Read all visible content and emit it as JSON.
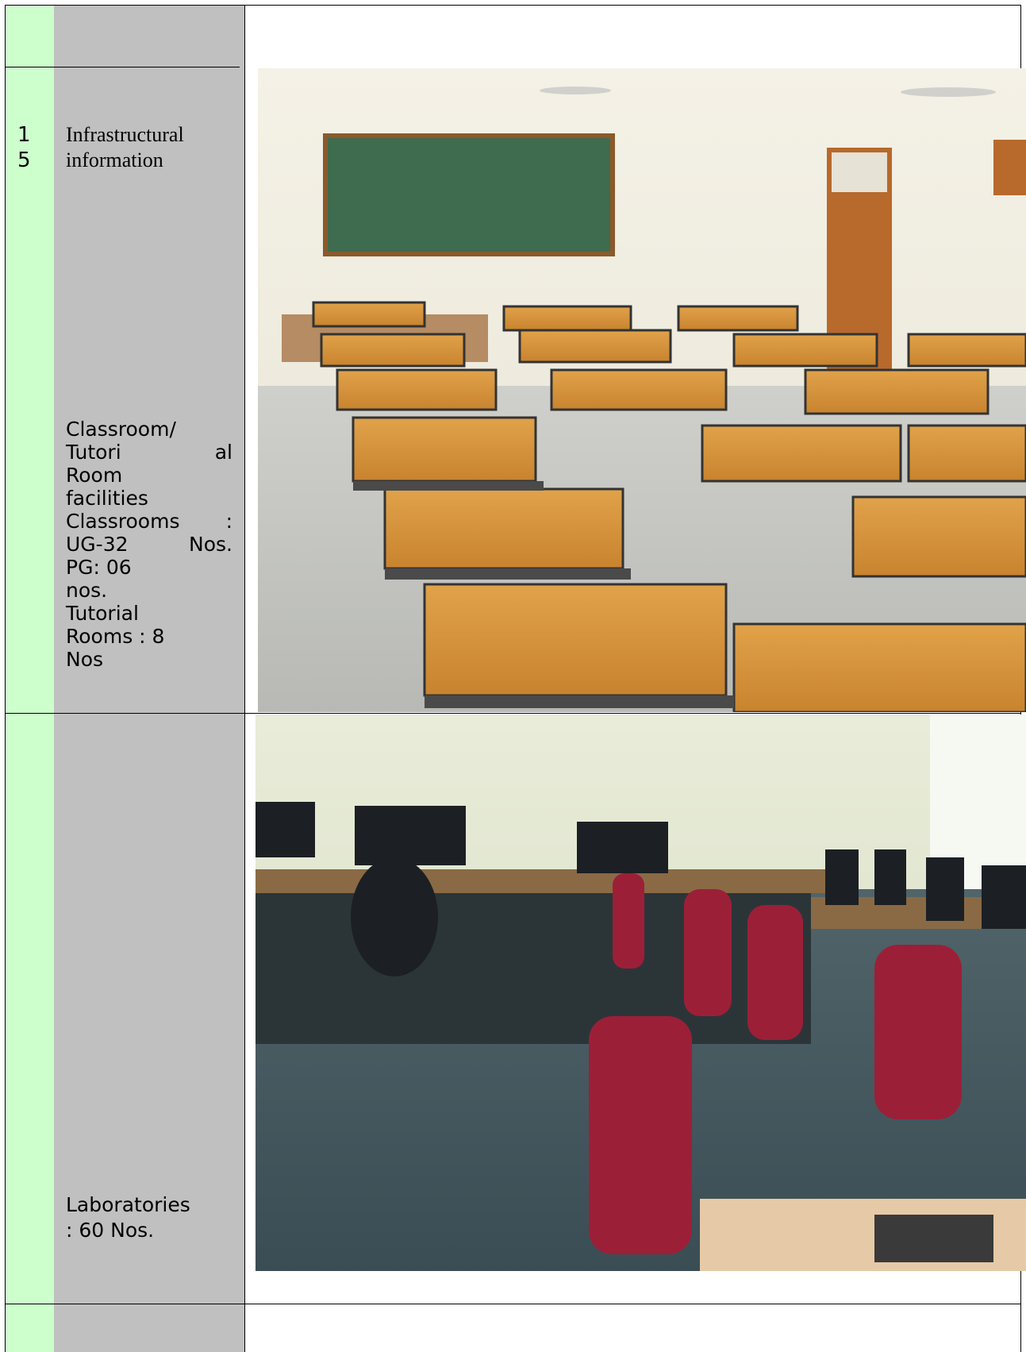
{
  "rows": {
    "serial": "1 5",
    "serial_lines": [
      "1",
      "5"
    ],
    "heading": "Infrastructural information",
    "classroom": {
      "lines": [
        "Classroom/",
        "Tutori|al",
        "Room",
        "facilities",
        "Classrooms|:",
        "UG-32|Nos.",
        "PG: 06",
        "nos.",
        "Tutorial",
        "Rooms  :  8",
        "Nos"
      ]
    },
    "laboratories": {
      "lines": [
        "Laboratories",
        ": 60 Nos."
      ]
    }
  },
  "photos": {
    "classroom_photo": "classroom photo",
    "lab_photo": "computer laboratory photo"
  },
  "colors": {
    "number_column": "#ccffcc",
    "label_column": "#c0c0c0",
    "border": "#000000"
  }
}
